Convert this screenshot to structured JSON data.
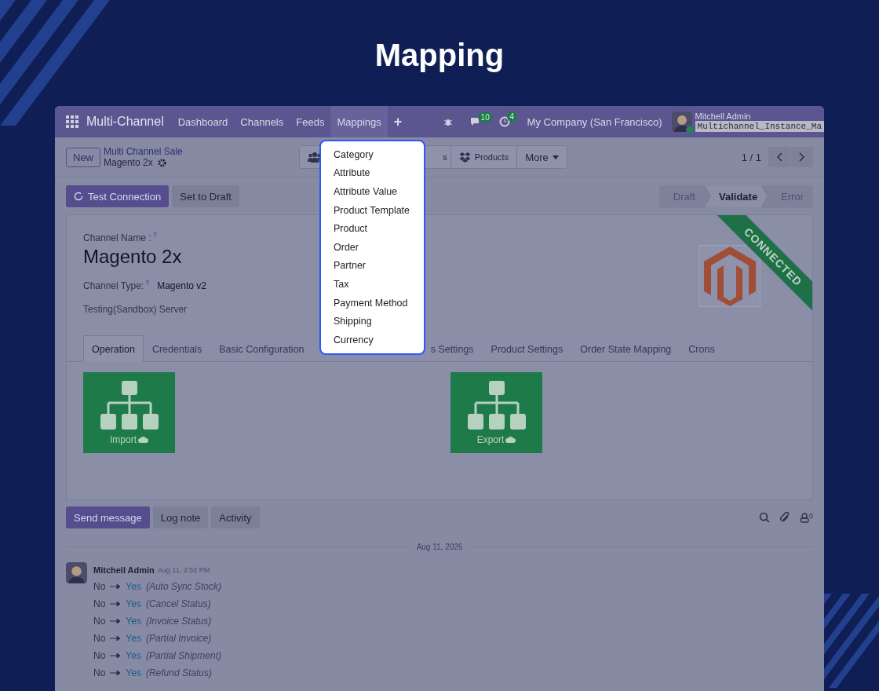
{
  "heading": "Mapping",
  "navbar": {
    "app_name": "Multi-Channel",
    "menus": [
      {
        "label": "Dashboard",
        "selected": false
      },
      {
        "label": "Channels",
        "selected": false
      },
      {
        "label": "Feeds",
        "selected": false
      },
      {
        "label": "Mappings",
        "selected": true
      }
    ],
    "plus": "+",
    "messages_badge": "10",
    "activities_badge": "4",
    "company": "My Company (San Francisco)",
    "user": "Mitchell Admin",
    "database": "Multichannel_Instance_Ma"
  },
  "control_panel": {
    "new_button": "New",
    "breadcrumb": "Multi Channel Sale",
    "record": "Magento 2x",
    "smart_buttons": [
      {
        "kind": "icon"
      },
      {
        "kind": "text",
        "label": "s"
      },
      {
        "kind": "products",
        "label": "Products"
      },
      {
        "kind": "more",
        "label": "More"
      }
    ],
    "pager": "1 / 1"
  },
  "dropdown": {
    "items": [
      "Category",
      "Attribute",
      "Attribute Value",
      "Product Template",
      "Product",
      "Order",
      "Partner",
      "Tax",
      "Payment Method",
      "Shipping",
      "Currency"
    ]
  },
  "actions": [
    {
      "label": "Test Connection",
      "kind": "primary"
    },
    {
      "label": "Set to Draft",
      "kind": "secondary"
    }
  ],
  "status_steps": [
    {
      "label": "Draft",
      "selected": false
    },
    {
      "label": "Validate",
      "selected": true
    },
    {
      "label": "Error",
      "selected": false
    }
  ],
  "form": {
    "channel_name_label": "Channel Name :",
    "help_mark": "?",
    "channel_name": "Magento 2x",
    "channel_type_label": "Channel Type:",
    "channel_type": "Magento v2",
    "server": "Testing(Sandbox) Server",
    "ribbon": "CONNECTED"
  },
  "tabs": [
    {
      "label": "Operation",
      "selected": true
    },
    {
      "label": "Credentials",
      "selected": false
    },
    {
      "label": "Basic Configuration",
      "selected": false
    },
    {
      "label": "s Settings",
      "selected": false
    },
    {
      "label": "Product Settings",
      "selected": false
    },
    {
      "label": "Order State Mapping",
      "selected": false
    },
    {
      "label": "Crons",
      "selected": false
    }
  ],
  "operations": [
    {
      "label": "Import"
    },
    {
      "label": "Export"
    }
  ],
  "chatter": {
    "buttons": [
      {
        "label": "Send message",
        "kind": "primary"
      },
      {
        "label": "Log note",
        "kind": "secondary"
      },
      {
        "label": "Activity",
        "kind": "secondary"
      }
    ],
    "followers": "0",
    "date": "Aug 11, 2026",
    "author": "Mitchell Admin",
    "time": "Aug 11, 2:52 PM",
    "changes": [
      {
        "old": "No",
        "new": "Yes",
        "field": "(Auto Sync Stock)"
      },
      {
        "old": "No",
        "new": "Yes",
        "field": "(Cancel Status)"
      },
      {
        "old": "No",
        "new": "Yes",
        "field": "(Invoice Status)"
      },
      {
        "old": "No",
        "new": "Yes",
        "field": "(Partial Invoice)"
      },
      {
        "old": "No",
        "new": "Yes",
        "field": "(Partial Shipment)"
      },
      {
        "old": "No",
        "new": "Yes",
        "field": "(Refund Status)"
      }
    ]
  }
}
